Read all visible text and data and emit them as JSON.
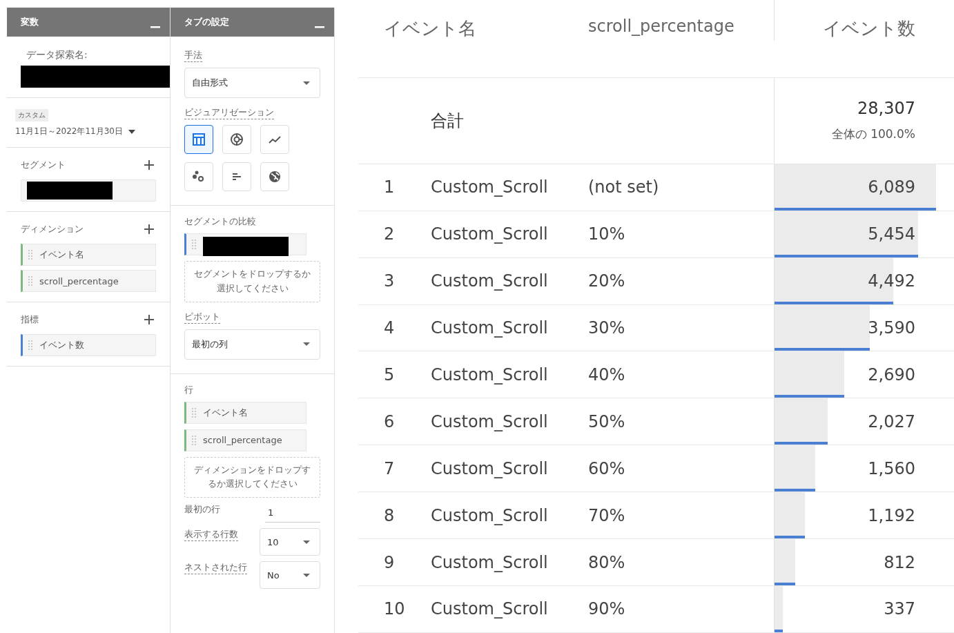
{
  "variables_panel": {
    "title": "変数",
    "exploration_name_label": "データ探索名:",
    "date_range": {
      "badge": "カスタム",
      "value": "11月1日～2022年11月30日"
    },
    "segments": {
      "title": "セグメント"
    },
    "dimensions": {
      "title": "ディメンション",
      "items": [
        "イベント名",
        "scroll_percentage"
      ]
    },
    "metrics": {
      "title": "指標",
      "items": [
        "イベント数"
      ]
    }
  },
  "tab_settings": {
    "title": "タブの設定",
    "technique": {
      "label": "手法",
      "value": "自由形式"
    },
    "visualization": {
      "label": "ビジュアリゼーション",
      "options": [
        {
          "kind": "table",
          "selected": true
        },
        {
          "kind": "donut",
          "selected": false
        },
        {
          "kind": "line",
          "selected": false
        },
        {
          "kind": "scatter",
          "selected": false
        },
        {
          "kind": "bar",
          "selected": false
        },
        {
          "kind": "globe",
          "selected": false
        }
      ]
    },
    "segment_comparison": {
      "label": "セグメントの比較",
      "drop_hint": "セグメントをドロップするか選択してください"
    },
    "pivot": {
      "label": "ピボット",
      "value": "最初の列"
    },
    "rows": {
      "label": "行",
      "items": [
        "イベント名",
        "scroll_percentage"
      ],
      "drop_hint": "ディメンションをドロップするか選択してください"
    },
    "first_row": {
      "label": "最初の行",
      "value": "1"
    },
    "rows_shown": {
      "label": "表示する行数",
      "value": "10"
    },
    "nested_rows": {
      "label": "ネストされた行",
      "value": "No"
    }
  },
  "table": {
    "columns": [
      "イベント名",
      "scroll_percentage",
      "イベント数"
    ],
    "total": {
      "label": "合計",
      "value": "28,307",
      "share": "全体の 100.0%"
    },
    "rows": [
      {
        "rank": "1",
        "event": "Custom_Scroll",
        "scroll": "(not set)",
        "count": "6,089",
        "level": 0.9
      },
      {
        "rank": "2",
        "event": "Custom_Scroll",
        "scroll": "10%",
        "count": "5,454",
        "level": 0.8
      },
      {
        "rank": "3",
        "event": "Custom_Scroll",
        "scroll": "20%",
        "count": "4,492",
        "level": 0.66
      },
      {
        "rank": "4",
        "event": "Custom_Scroll",
        "scroll": "30%",
        "count": "3,590",
        "level": 0.53
      },
      {
        "rank": "5",
        "event": "Custom_Scroll",
        "scroll": "40%",
        "count": "2,690",
        "level": 0.39
      },
      {
        "rank": "6",
        "event": "Custom_Scroll",
        "scroll": "50%",
        "count": "2,027",
        "level": 0.295
      },
      {
        "rank": "7",
        "event": "Custom_Scroll",
        "scroll": "60%",
        "count": "1,560",
        "level": 0.225
      },
      {
        "rank": "8",
        "event": "Custom_Scroll",
        "scroll": "70%",
        "count": "1,192",
        "level": 0.17
      },
      {
        "rank": "9",
        "event": "Custom_Scroll",
        "scroll": "80%",
        "count": "812",
        "level": 0.115
      },
      {
        "rank": "10",
        "event": "Custom_Scroll",
        "scroll": "90%",
        "count": "337",
        "level": 0.045
      }
    ]
  }
}
